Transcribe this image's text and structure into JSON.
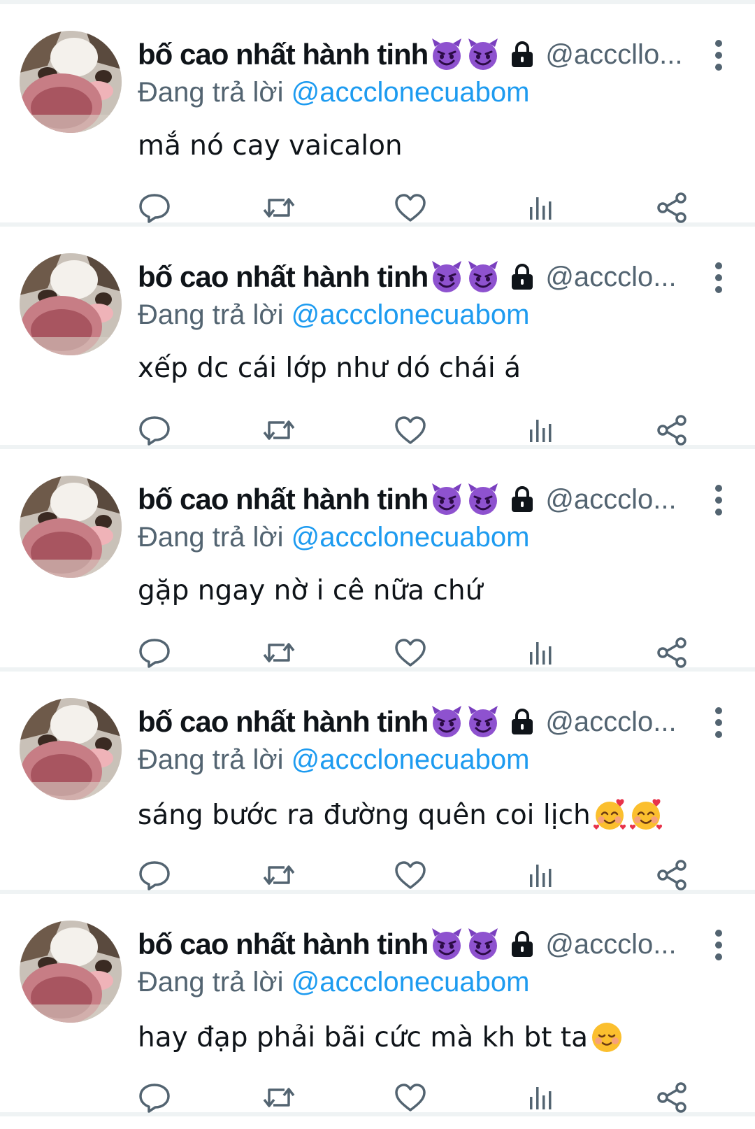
{
  "tweets": [
    {
      "display_name": "bố cao nhất hành tinh",
      "name_emojis": [
        "smiling-imp",
        "smiling-imp"
      ],
      "protected": true,
      "handle": "@acccllo...",
      "reply_prefix": "Đang trả lời",
      "reply_to": "@accclonecuabom",
      "text": "mắ nó cay vaicalon",
      "text_emojis": []
    },
    {
      "display_name": "bố cao nhất hành tinh",
      "name_emojis": [
        "smiling-imp",
        "smiling-imp"
      ],
      "protected": true,
      "handle": "@accclo...",
      "reply_prefix": "Đang trả lời",
      "reply_to": "@accclonecuabom",
      "text": "xếp dc cái lớp như dó chái á",
      "text_emojis": []
    },
    {
      "display_name": "bố cao nhất hành tinh",
      "name_emojis": [
        "smiling-imp",
        "smiling-imp"
      ],
      "protected": true,
      "handle": "@accclo...",
      "reply_prefix": "Đang trả lời",
      "reply_to": "@accclonecuabom",
      "text": "gặp ngay nờ i cê nữa chứ",
      "text_emojis": []
    },
    {
      "display_name": "bố cao nhất hành tinh",
      "name_emojis": [
        "smiling-imp",
        "smiling-imp"
      ],
      "protected": true,
      "handle": "@accclo...",
      "reply_prefix": "Đang trả lời",
      "reply_to": "@accclonecuabom",
      "text": "sáng bước ra đường quên coi lịch",
      "text_emojis": [
        "smiling-face-with-hearts",
        "smiling-face-with-hearts"
      ]
    },
    {
      "display_name": "bố cao nhất hành tinh",
      "name_emojis": [
        "smiling-imp",
        "smiling-imp"
      ],
      "protected": true,
      "handle": "@accclo...",
      "reply_prefix": "Đang trả lời",
      "reply_to": "@accclonecuabom",
      "text": "hay đạp phải bãi cức mà kh bt ta",
      "text_emojis": [
        "relieved-smiling-face"
      ]
    }
  ],
  "actions": [
    "reply-icon",
    "retweet-icon",
    "like-icon",
    "views-icon",
    "share-icon"
  ],
  "colors": {
    "text": "#0f1419",
    "secondary": "#536471",
    "link": "#1d9bf0",
    "divider": "#eff3f4",
    "imp_purple": "#8a4fc9"
  }
}
